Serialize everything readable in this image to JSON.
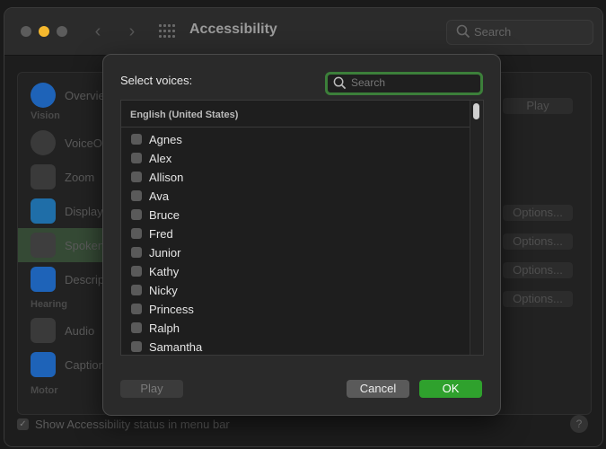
{
  "window": {
    "title": "Accessibility",
    "search_placeholder": "Search"
  },
  "sidebar": {
    "sections": {
      "vision": "Vision",
      "hearing": "Hearing",
      "motor": "Motor"
    },
    "items": [
      {
        "label": "Overview",
        "icon": "accessibility-icon",
        "color": "#1e63b8"
      },
      {
        "label": "VoiceOver",
        "icon": "voiceover-icon",
        "color": "#3a3a3a"
      },
      {
        "label": "Zoom",
        "icon": "zoom-icon",
        "color": "#3a3a3a"
      },
      {
        "label": "Display",
        "icon": "display-icon",
        "color": "#1f6ea8"
      },
      {
        "label": "Spoken Content",
        "icon": "speech-bubble-icon",
        "color": "#3e3e3e"
      },
      {
        "label": "Descriptions",
        "icon": "descriptions-icon",
        "color": "#1e63b8"
      },
      {
        "label": "Audio",
        "icon": "speaker-icon",
        "color": "#3a3a3a"
      },
      {
        "label": "Captions",
        "icon": "captions-icon",
        "color": "#1e63b8"
      }
    ]
  },
  "right_pane": {
    "play_label": "Play",
    "options_label": "Options..."
  },
  "footer": {
    "status_label": "Show Accessibility status in menu bar",
    "checked": true,
    "help": "?"
  },
  "dialog": {
    "title": "Select voices:",
    "search_placeholder": "Search",
    "group_header": "English (United States)",
    "voices": [
      "Agnes",
      "Alex",
      "Allison",
      "Ava",
      "Bruce",
      "Fred",
      "Junior",
      "Kathy",
      "Nicky",
      "Princess",
      "Ralph",
      "Samantha"
    ],
    "play_label": "Play",
    "cancel_label": "Cancel",
    "ok_label": "OK",
    "accent_color": "#2fa12d"
  }
}
